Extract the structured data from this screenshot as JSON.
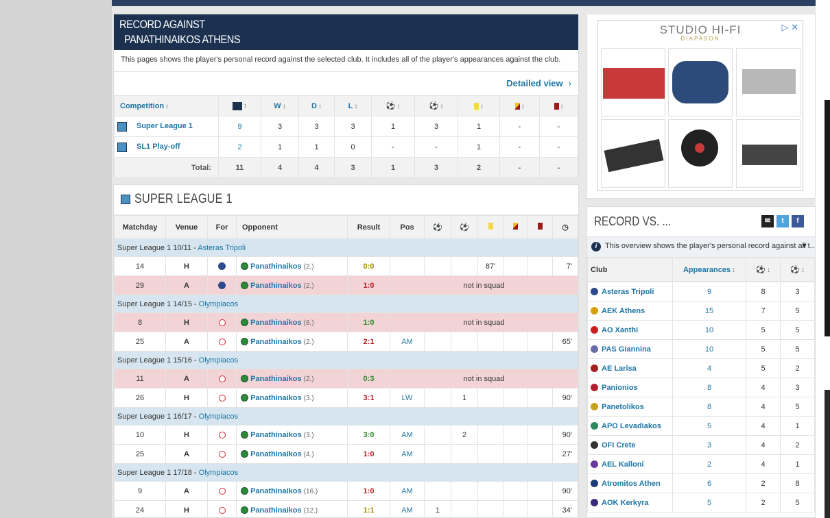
{
  "record": {
    "title1": "RECORD AGAINST",
    "title2": "PANATHINAIKOS ATHENS",
    "description": "This pages shows the player's personal record against the selected club. It includes all of the player's appearances against the club.",
    "detailed_view": "Detailed view",
    "headers": {
      "competition": "Competition",
      "w": "W",
      "d": "D",
      "l": "L"
    },
    "rows": [
      {
        "competition": "Super League 1",
        "apps": "9",
        "w": "3",
        "d": "3",
        "l": "3",
        "goals": "1",
        "assists": "3",
        "yellow": "1",
        "second_yellow": "-",
        "red": "-"
      },
      {
        "competition": "SL1 Play-off",
        "apps": "2",
        "w": "1",
        "d": "1",
        "l": "0",
        "goals": "-",
        "assists": "-",
        "yellow": "1",
        "second_yellow": "-",
        "red": "-"
      }
    ],
    "total": {
      "label": "Total:",
      "apps": "11",
      "w": "4",
      "d": "4",
      "l": "3",
      "goals": "1",
      "assists": "3",
      "yellow": "2",
      "second_yellow": "-",
      "red": "-"
    }
  },
  "superleague": {
    "title": "SUPER LEAGUE 1",
    "headers": {
      "matchday": "Matchday",
      "venue": "Venue",
      "for": "For",
      "opponent": "Opponent",
      "result": "Result",
      "pos": "Pos"
    },
    "seasons": [
      {
        "label": "Super League 1 10/11 - ",
        "club": "Asteras Tripoli"
      },
      {
        "label": "Super League 1 14/15 - ",
        "club": "Olympiacos"
      },
      {
        "label": "Super League 1 15/16 - ",
        "club": "Olympiacos"
      },
      {
        "label": "Super League 1 16/17 - ",
        "club": "Olympiacos"
      },
      {
        "label": "Super League 1 17/18 - ",
        "club": "Olympiacos"
      }
    ],
    "matches": [
      {
        "md": "14",
        "venue": "H",
        "opp": "Panathinaikos",
        "rank": "(2.)",
        "result": "0:0",
        "pos": "",
        "goals": "",
        "assists": "",
        "yellow": "87'",
        "mins": "7'"
      },
      {
        "md": "29",
        "venue": "A",
        "opp": "Panathinaikos",
        "rank": "(2.)",
        "result": "1:0",
        "note": "not in squad"
      },
      {
        "md": "8",
        "venue": "H",
        "opp": "Panathinaikos",
        "rank": "(8.)",
        "result": "1:0",
        "note": "not in squad"
      },
      {
        "md": "25",
        "venue": "A",
        "opp": "Panathinaikos",
        "rank": "(2.)",
        "result": "2:1",
        "pos": "AM",
        "goals": "",
        "assists": "",
        "yellow": "",
        "mins": "65'"
      },
      {
        "md": "11",
        "venue": "A",
        "opp": "Panathinaikos",
        "rank": "(2.)",
        "result": "0:3",
        "note": "not in squad"
      },
      {
        "md": "26",
        "venue": "H",
        "opp": "Panathinaikos",
        "rank": "(3.)",
        "result": "3:1",
        "pos": "LW",
        "goals": "",
        "assists": "1",
        "yellow": "",
        "mins": "90'"
      },
      {
        "md": "10",
        "venue": "H",
        "opp": "Panathinaikos",
        "rank": "(3.)",
        "result": "3:0",
        "pos": "AM",
        "goals": "",
        "assists": "2",
        "yellow": "",
        "mins": "90'"
      },
      {
        "md": "25",
        "venue": "A",
        "opp": "Panathinaikos",
        "rank": "(4.)",
        "result": "1:0",
        "pos": "AM",
        "goals": "",
        "assists": "",
        "yellow": "",
        "mins": "27'"
      },
      {
        "md": "9",
        "venue": "A",
        "opp": "Panathinaikos",
        "rank": "(16.)",
        "result": "1:0",
        "pos": "AM",
        "goals": "",
        "assists": "",
        "yellow": "",
        "mins": "90'"
      },
      {
        "md": "24",
        "venue": "H",
        "opp": "Panathinaikos",
        "rank": "(12.)",
        "result": "1:1",
        "pos": "AM",
        "goals": "1",
        "assists": "",
        "yellow": "",
        "mins": "34'"
      }
    ]
  },
  "ad": {
    "brand": "STUDIO HI-FI",
    "sub": "DIAPASON"
  },
  "recordvs": {
    "title": "RECORD VS. ...",
    "info": "This overview shows the player's personal record against all t...",
    "headers": {
      "club": "Club",
      "appearances": "Appearances"
    },
    "clubs": [
      {
        "name": "Asteras Tripoli",
        "apps": "9",
        "goals": "8",
        "assists": "3",
        "color": "#2c4a8c"
      },
      {
        "name": "AEK Athens",
        "apps": "15",
        "goals": "7",
        "assists": "5",
        "color": "#d4a010"
      },
      {
        "name": "AO Xanthi",
        "apps": "10",
        "goals": "5",
        "assists": "5",
        "color": "#c82020"
      },
      {
        "name": "PAS Giannina",
        "apps": "10",
        "goals": "5",
        "assists": "5",
        "color": "#6a6aa8"
      },
      {
        "name": "AE Larisa",
        "apps": "4",
        "goals": "5",
        "assists": "2",
        "color": "#a02020"
      },
      {
        "name": "Panionios",
        "apps": "8",
        "goals": "4",
        "assists": "3",
        "color": "#b02030"
      },
      {
        "name": "Panetolikos",
        "apps": "8",
        "goals": "4",
        "assists": "5",
        "color": "#c8a020"
      },
      {
        "name": "APO Levadiakos",
        "apps": "5",
        "goals": "4",
        "assists": "1",
        "color": "#2a8a5a"
      },
      {
        "name": "OFI Crete",
        "apps": "3",
        "goals": "4",
        "assists": "2",
        "color": "#333333"
      },
      {
        "name": "AEL Kalloni",
        "apps": "2",
        "goals": "4",
        "assists": "1",
        "color": "#6a3a9a"
      },
      {
        "name": "Atromitos Athen",
        "apps": "6",
        "goals": "2",
        "assists": "8",
        "color": "#1c3a7a"
      },
      {
        "name": "AOK Kerkyra",
        "apps": "5",
        "goals": "2",
        "assists": "5",
        "color": "#3a2a7a"
      }
    ]
  }
}
